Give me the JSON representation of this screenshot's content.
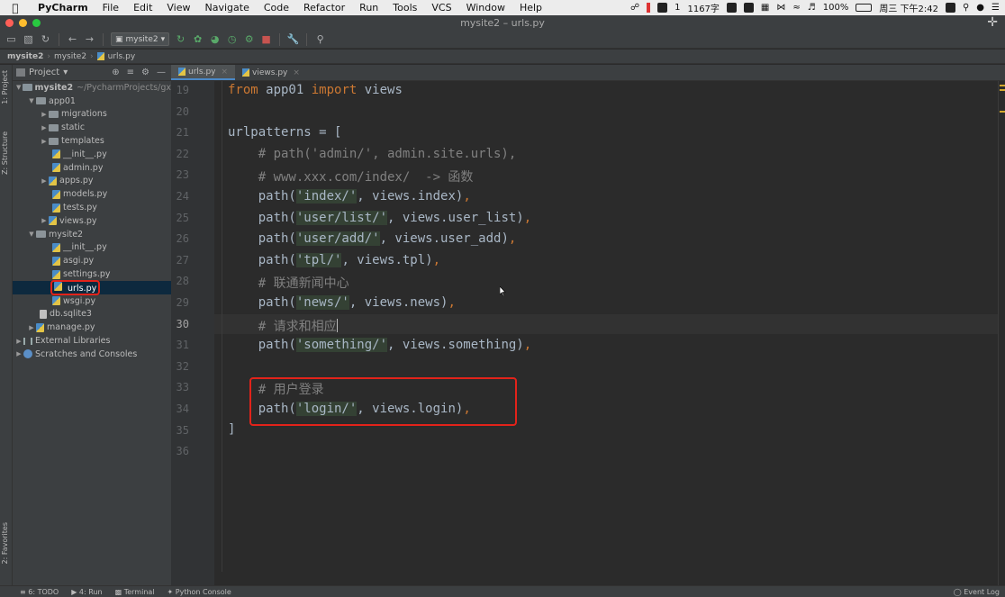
{
  "menubar": {
    "app": "PyCharm",
    "items": [
      "File",
      "Edit",
      "View",
      "Navigate",
      "Code",
      "Refactor",
      "Run",
      "Tools",
      "VCS",
      "Window",
      "Help"
    ],
    "status_items": [
      "1",
      "1167字"
    ],
    "battery": "100%",
    "datetime": "周三 下午2:42"
  },
  "window": {
    "title": "mysite2 – urls.py"
  },
  "toolbar": {
    "run_config": "mysite2"
  },
  "breadcrumb": [
    "mysite2",
    "mysite2",
    "urls.py"
  ],
  "sidebar_tabs": {
    "project": "1: Project",
    "structure": "Z: Structure",
    "favorites": "2: Favorites"
  },
  "project_panel": {
    "title": "Project",
    "root_name": "mysite2",
    "root_path": "~/PycharmProjects/gx",
    "items": [
      {
        "label": "app01"
      },
      {
        "label": "migrations"
      },
      {
        "label": "static"
      },
      {
        "label": "templates"
      },
      {
        "label": "__init__.py"
      },
      {
        "label": "admin.py"
      },
      {
        "label": "apps.py"
      },
      {
        "label": "models.py"
      },
      {
        "label": "tests.py"
      },
      {
        "label": "views.py"
      },
      {
        "label": "mysite2"
      },
      {
        "label": "__init__.py"
      },
      {
        "label": "asgi.py"
      },
      {
        "label": "settings.py"
      },
      {
        "label": "urls.py"
      },
      {
        "label": "wsgi.py"
      },
      {
        "label": "db.sqlite3"
      },
      {
        "label": "manage.py"
      },
      {
        "label": "External Libraries"
      },
      {
        "label": "Scratches and Consoles"
      }
    ]
  },
  "editor_tabs": [
    {
      "label": "urls.py"
    },
    {
      "label": "views.py"
    }
  ],
  "code": {
    "line_numbers": [
      "19",
      "20",
      "21",
      "22",
      "23",
      "24",
      "25",
      "26",
      "27",
      "28",
      "29",
      "30",
      "31",
      "32",
      "33",
      "34",
      "35",
      "36"
    ],
    "l19_from": "from",
    "l19_mid": " app01 ",
    "l19_import": "import",
    "l19_end": " views",
    "l21": "urlpatterns = [",
    "l22": "    # path('admin/', admin.site.urls),",
    "l23": "    # www.xxx.com/index/  -> 函数",
    "l24_a": "    path(",
    "l24_s": "'index/'",
    "l24_b": ", views.index)",
    "l25_a": "    path(",
    "l25_s": "'user/list/'",
    "l25_b": ", views.user_list)",
    "l26_a": "    path(",
    "l26_s": "'user/add/'",
    "l26_b": ", views.user_add)",
    "l27_a": "    path(",
    "l27_s": "'tpl/'",
    "l27_b": ", views.tpl)",
    "l28": "    # 联通新闻中心",
    "l29_a": "    path(",
    "l29_s": "'news/'",
    "l29_b": ", views.news)",
    "l30": "    # 请求和相应",
    "l31_a": "    path(",
    "l31_s": "'something/'",
    "l31_b": ", views.something)",
    "l33": "    # 用户登录",
    "l34_a": "    path(",
    "l34_s": "'login/'",
    "l34_b": ", views.login)",
    "l35": "]",
    "comma": ","
  },
  "bottom_bar": {
    "todo": "6: TODO",
    "run": "4: Run",
    "terminal": "Terminal",
    "python_console": "Python Console",
    "event_log": "Event Log"
  }
}
